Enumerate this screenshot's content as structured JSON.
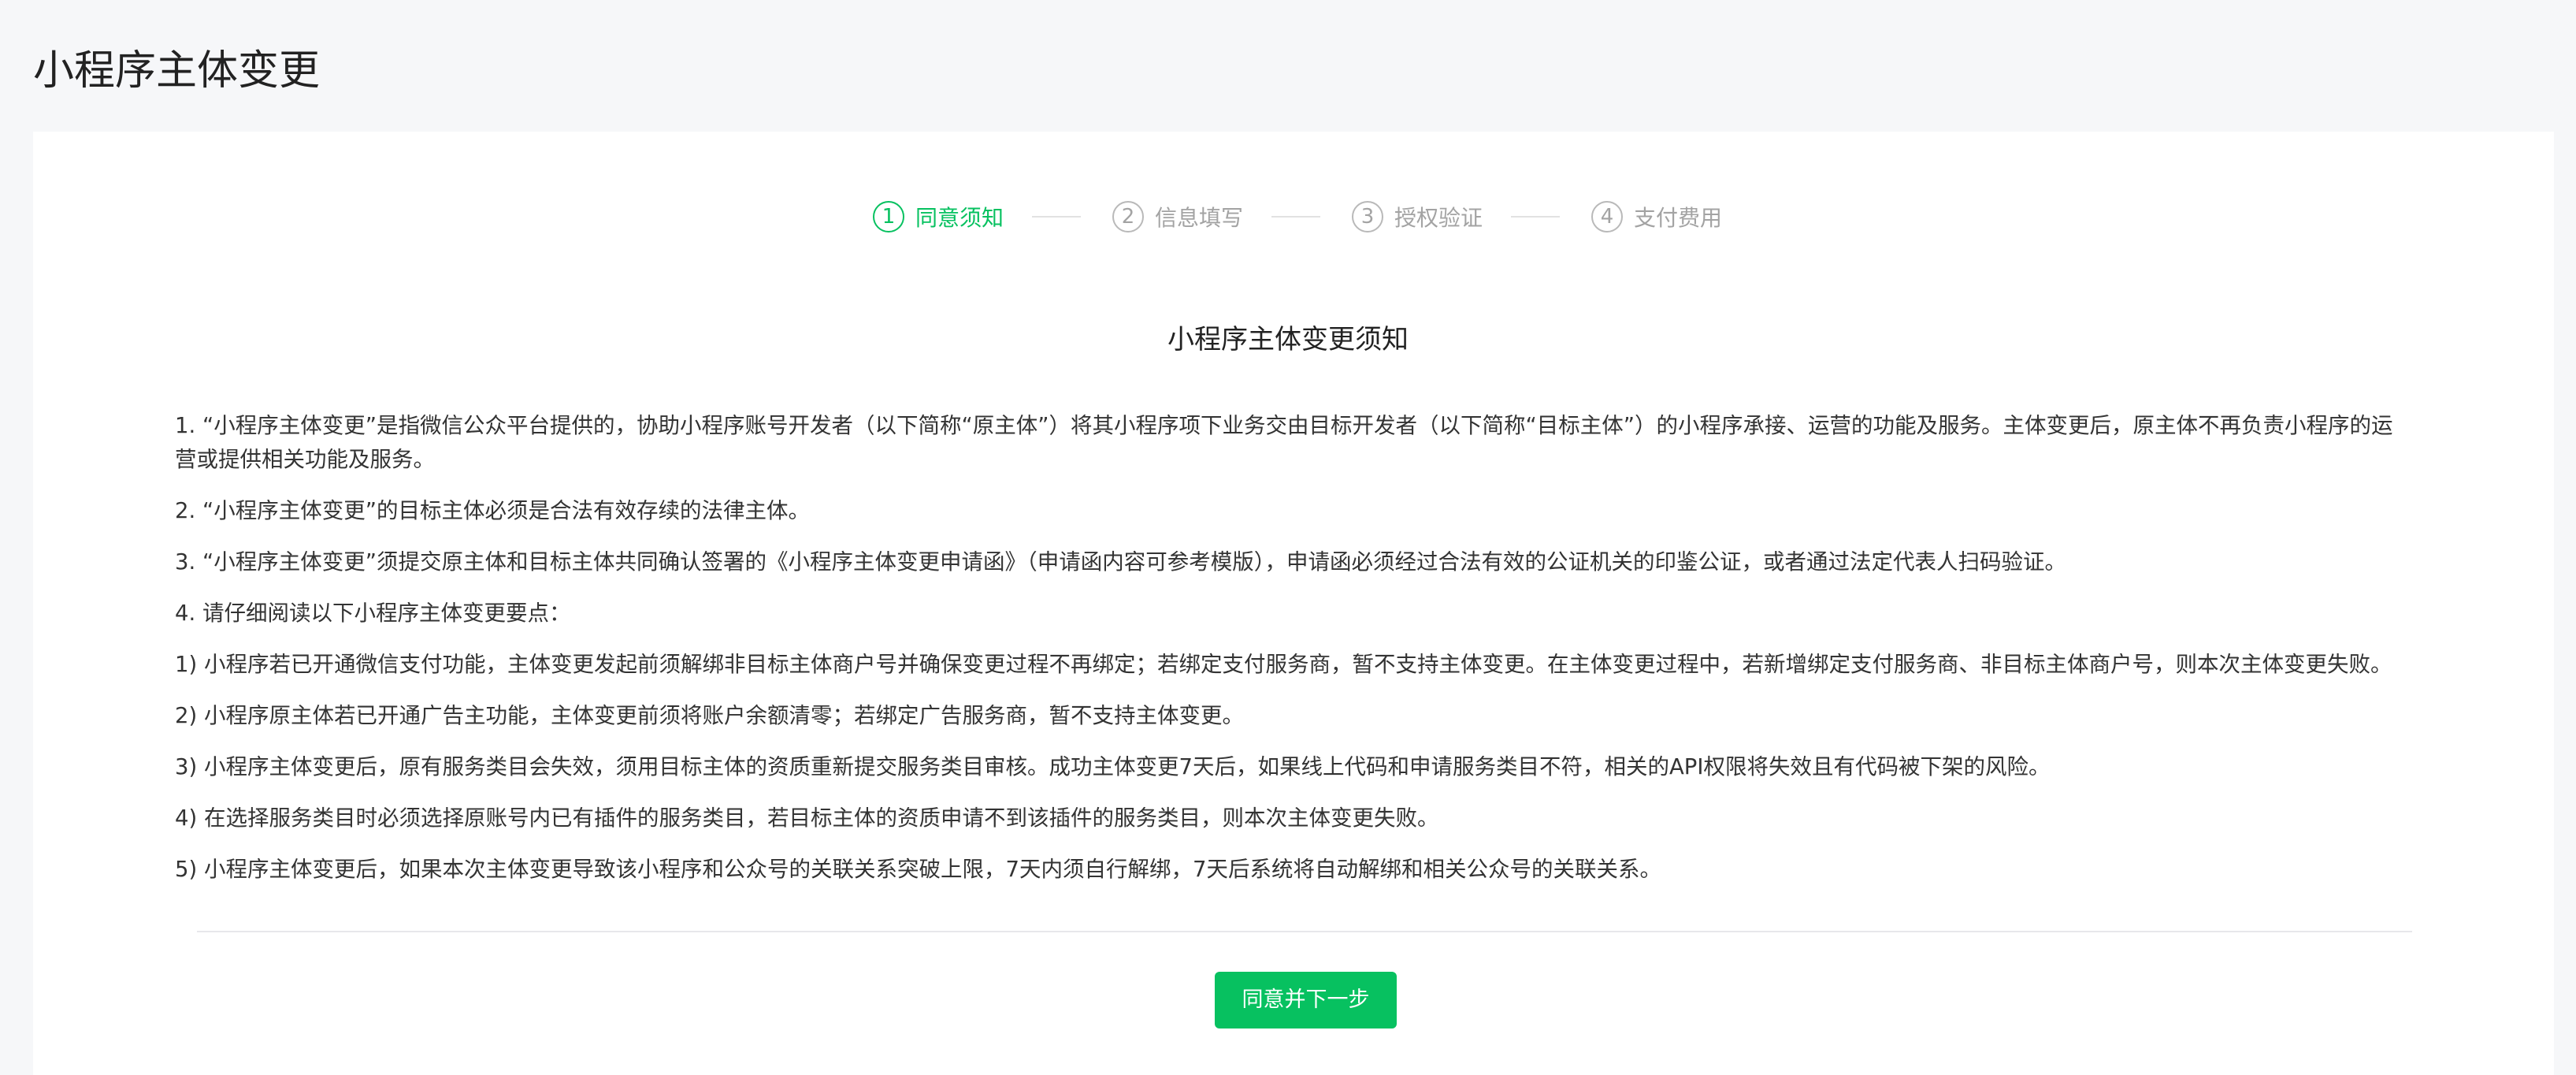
{
  "page": {
    "title": "小程序主体变更"
  },
  "steps": [
    {
      "number": "1",
      "label": "同意须知",
      "active": true
    },
    {
      "number": "2",
      "label": "信息填写",
      "active": false
    },
    {
      "number": "3",
      "label": "授权验证",
      "active": false
    },
    {
      "number": "4",
      "label": "支付费用",
      "active": false
    }
  ],
  "notice": {
    "title": "小程序主体变更须知",
    "paragraphs": [
      "1. “小程序主体变更”是指微信公众平台提供的，协助小程序账号开发者（以下简称“原主体”）将其小程序项下业务交由目标开发者（以下简称“目标主体”）的小程序承接、运营的功能及服务。主体变更后，原主体不再负责小程序的运营或提供相关功能及服务。",
      "2. “小程序主体变更”的目标主体必须是合法有效存续的法律主体。",
      "3. “小程序主体变更”须提交原主体和目标主体共同确认签署的《小程序主体变更申请函》（申请函内容可参考模版），申请函必须经过合法有效的公证机关的印鉴公证，或者通过法定代表人扫码验证。",
      "4. 请仔细阅读以下小程序主体变更要点：",
      "1) 小程序若已开通微信支付功能，主体变更发起前须解绑非目标主体商户号并确保变更过程不再绑定；若绑定支付服务商，暂不支持主体变更。在主体变更过程中，若新增绑定支付服务商、非目标主体商户号，则本次主体变更失败。",
      "2) 小程序原主体若已开通广告主功能，主体变更前须将账户余额清零；若绑定广告服务商，暂不支持主体变更。",
      "3) 小程序主体变更后，原有服务类目会失效，须用目标主体的资质重新提交服务类目审核。成功主体变更7天后，如果线上代码和申请服务类目不符，相关的API权限将失效且有代码被下架的风险。",
      "4) 在选择服务类目时必须选择原账号内已有插件的服务类目，若目标主体的资质申请不到该插件的服务类目，则本次主体变更失败。",
      "5) 小程序主体变更后，如果本次主体变更导致该小程序和公众号的关联关系突破上限，7天内须自行解绑，7天后系统将自动解绑和相关公众号的关联关系。"
    ]
  },
  "actions": {
    "agree_next_label": "同意并下一步"
  },
  "colors": {
    "accent": "#07c160",
    "inactive": "#a3a3a3",
    "background": "#f6f7f9"
  }
}
